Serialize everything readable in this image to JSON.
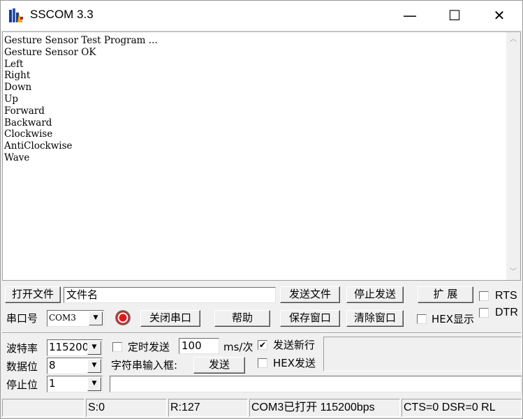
{
  "window": {
    "title": "SSCOM 3.3",
    "minimize_glyph": "—",
    "maximize_glyph": "☐",
    "close_glyph": "✕"
  },
  "log": {
    "lines": "Gesture Sensor Test Program ...\nGesture Sensor OK\nLeft\nRight\nDown\nUp\nForward\nBackward\nClockwise\nAntiClockwise\nWave"
  },
  "controls": {
    "open_file": "打开文件",
    "file_name": "文件名",
    "send_file": "发送文件",
    "stop_send": "停止发送",
    "expand": "扩 展",
    "rts": "RTS",
    "dtr": "DTR",
    "port_label": "串口号",
    "port_value": "COM3",
    "close_port": "关闭串口",
    "help": "帮助",
    "save_window": "保存窗口",
    "clear_window": "清除窗口",
    "hex_display": "HEX显示",
    "baud_label": "波特率",
    "baud_value": "115200",
    "timed_send": "定时发送",
    "interval_value": "100",
    "interval_unit": "ms/次",
    "send_newline": "发送新行",
    "databits_label": "数据位",
    "databits_value": "8",
    "string_input_label": "字符串输入框:",
    "send": "发送",
    "hex_send": "HEX发送",
    "stopbits_label": "停止位",
    "stopbits_value": "1",
    "send_input_value": ""
  },
  "status": {
    "blank": "",
    "sent": "S:0",
    "received": "R:127",
    "port_state": "COM3已打开  115200bps",
    "lines": "CTS=0 DSR=0 RL"
  },
  "colors": {
    "lamp": "#e01818",
    "face": "#f0f0f0"
  }
}
